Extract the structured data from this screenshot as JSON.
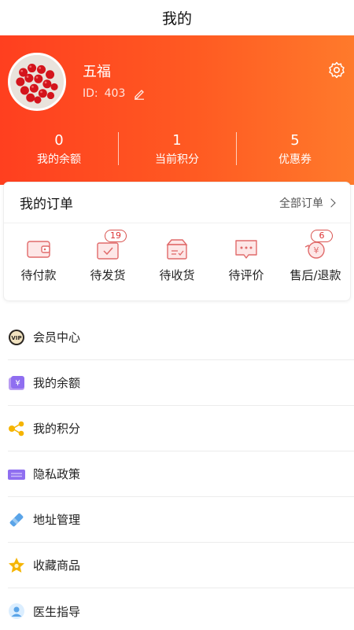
{
  "header": {
    "title": "我的"
  },
  "profile": {
    "name": "五福",
    "id_label": "ID:",
    "id_value": "403"
  },
  "stats": [
    {
      "value": "0",
      "label": "我的余额"
    },
    {
      "value": "1",
      "label": "当前积分"
    },
    {
      "value": "5",
      "label": "优惠券"
    }
  ],
  "orders": {
    "title": "我的订单",
    "all_label": "全部订单",
    "items": [
      {
        "label": "待付款",
        "badge": ""
      },
      {
        "label": "待发货",
        "badge": "19"
      },
      {
        "label": "待收货",
        "badge": ""
      },
      {
        "label": "待评价",
        "badge": ""
      },
      {
        "label": "售后/退款",
        "badge": "6"
      }
    ]
  },
  "menu": [
    {
      "label": "会员中心",
      "icon": "vip-icon"
    },
    {
      "label": "我的余额",
      "icon": "balance-icon"
    },
    {
      "label": "我的积分",
      "icon": "points-icon"
    },
    {
      "label": "隐私政策",
      "icon": "privacy-icon"
    },
    {
      "label": "地址管理",
      "icon": "address-icon"
    },
    {
      "label": "收藏商品",
      "icon": "favorite-icon"
    },
    {
      "label": "医生指导",
      "icon": "doctor-icon"
    }
  ],
  "colors": {
    "accent": "#ff4a1e",
    "accent_end": "#ff7a2b",
    "badge": "#d9534f",
    "order_icon": "#e06a6a"
  }
}
